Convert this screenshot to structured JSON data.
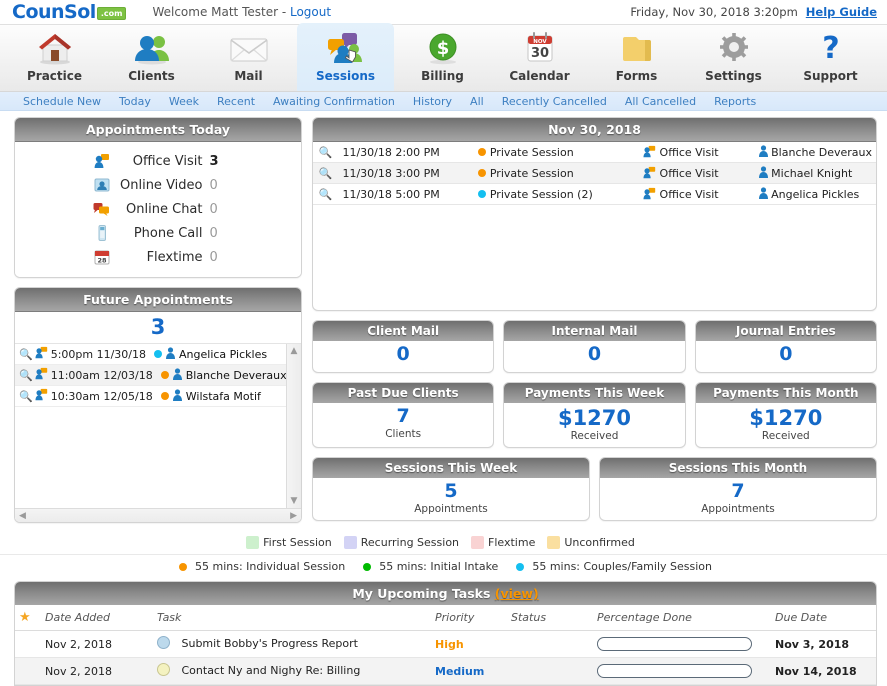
{
  "header": {
    "logo_text": "CounSol",
    "logo_badge": ".com",
    "welcome": "Welcome Matt Tester - ",
    "logout": "Logout",
    "datetime": "Friday, Nov 30, 2018  3:20pm",
    "help_guide": "Help Guide"
  },
  "nav": {
    "items": [
      {
        "label": "Practice",
        "icon": "house-icon",
        "active": false
      },
      {
        "label": "Clients",
        "icon": "people-icon",
        "active": false
      },
      {
        "label": "Mail",
        "icon": "envelope-icon",
        "active": false
      },
      {
        "label": "Sessions",
        "icon": "chat-people-icon",
        "active": true
      },
      {
        "label": "Billing",
        "icon": "dollar-circle-icon",
        "active": false
      },
      {
        "label": "Calendar",
        "icon": "calendar-icon",
        "active": false
      },
      {
        "label": "Forms",
        "icon": "folder-icon",
        "active": false
      },
      {
        "label": "Settings",
        "icon": "gear-icon",
        "active": false
      },
      {
        "label": "Support",
        "icon": "question-mark-icon",
        "active": false
      }
    ],
    "calendar_month": "NOV",
    "calendar_day": "30"
  },
  "subnav": {
    "items": [
      "Schedule New",
      "Today",
      "Week",
      "Recent",
      "Awaiting Confirmation",
      "History",
      "All",
      "Recently Cancelled",
      "All Cancelled",
      "Reports"
    ]
  },
  "appointments_today": {
    "title": "Appointments Today",
    "rows": [
      {
        "label": "Office Visit",
        "count": "3",
        "zero": false,
        "icon": "office-visit-icon"
      },
      {
        "label": "Online Video",
        "count": "0",
        "zero": true,
        "icon": "online-video-icon"
      },
      {
        "label": "Online Chat",
        "count": "0",
        "zero": true,
        "icon": "online-chat-icon"
      },
      {
        "label": "Phone Call",
        "count": "0",
        "zero": true,
        "icon": "phone-call-icon"
      },
      {
        "label": "Flextime",
        "count": "0",
        "zero": true,
        "icon": "flextime-calendar-icon"
      }
    ]
  },
  "future_appointments": {
    "title": "Future Appointments",
    "count": "3",
    "rows": [
      {
        "time": "5:00pm 11/30/18",
        "dot": "cyan",
        "name": "Angelica Pickles"
      },
      {
        "time": "11:00am 12/03/18",
        "dot": "orange",
        "name": "Blanche Deveraux"
      },
      {
        "time": "10:30am 12/05/18",
        "dot": "orange",
        "name": "Wilstafa Motif"
      }
    ]
  },
  "day_panel": {
    "title": "Nov 30, 2018",
    "rows": [
      {
        "time": "11/30/18 2:00 PM",
        "dot": "orange",
        "type": "Private Session",
        "visit": "Office Visit",
        "client": "Blanche Deveraux"
      },
      {
        "time": "11/30/18 3:00 PM",
        "dot": "orange",
        "type": "Private Session",
        "visit": "Office Visit",
        "client": "Michael Knight"
      },
      {
        "time": "11/30/18 5:00 PM",
        "dot": "cyan",
        "type": "Private Session (2)",
        "visit": "Office Visit",
        "client": "Angelica Pickles"
      }
    ]
  },
  "stats": {
    "row1": [
      {
        "title": "Client Mail",
        "value": "0",
        "sub": ""
      },
      {
        "title": "Internal Mail",
        "value": "0",
        "sub": ""
      },
      {
        "title": "Journal Entries",
        "value": "0",
        "sub": ""
      }
    ],
    "row2": [
      {
        "title": "Past Due Clients",
        "value": "7",
        "sub": "Clients"
      },
      {
        "title": "Payments This Week",
        "value": "$1270",
        "sub": "Received"
      },
      {
        "title": "Payments This Month",
        "value": "$1270",
        "sub": "Received"
      }
    ],
    "row3": [
      {
        "title": "Sessions This Week",
        "value": "5",
        "sub": "Appointments"
      },
      {
        "title": "Sessions This Month",
        "value": "7",
        "sub": "Appointments"
      }
    ]
  },
  "legend_swatches": [
    {
      "label": "First Session",
      "color": "#cdf0cd"
    },
    {
      "label": "Recurring Session",
      "color": "#d3d3f5"
    },
    {
      "label": "Flextime",
      "color": "#f9d3d3"
    },
    {
      "label": "Unconfirmed",
      "color": "#fadfa0"
    }
  ],
  "legend_dots": [
    {
      "label": "55 mins: Individual Session",
      "color": "#f79400"
    },
    {
      "label": "55 mins: Initial Intake",
      "color": "#00bb00"
    },
    {
      "label": "55 mins: Couples/Family Session",
      "color": "#14bff0"
    }
  ],
  "tasks": {
    "title": "My Upcoming Tasks ",
    "view_label": "(view)",
    "columns": [
      "",
      "Date Added",
      "Task",
      "Priority",
      "Status",
      "Percentage Done",
      "Due Date"
    ],
    "rows": [
      {
        "date_added": "Nov 2, 2018",
        "bubble": "blue",
        "task": "Submit Bobby's Progress Report",
        "priority": "High",
        "priority_class": "high",
        "status": "",
        "due_date": "Nov 3, 2018"
      },
      {
        "date_added": "Nov 2, 2018",
        "bubble": "yellow",
        "task": "Contact Ny and Nighy Re: Billing",
        "priority": "Medium",
        "priority_class": "medium",
        "status": "",
        "due_date": "Nov 14, 2018"
      }
    ]
  },
  "colors": {
    "brand_blue": "#1569c7",
    "accent_orange": "#f79400",
    "link_blue": "#3d7fc1",
    "panel_header_dark": "#6f6f6f"
  }
}
